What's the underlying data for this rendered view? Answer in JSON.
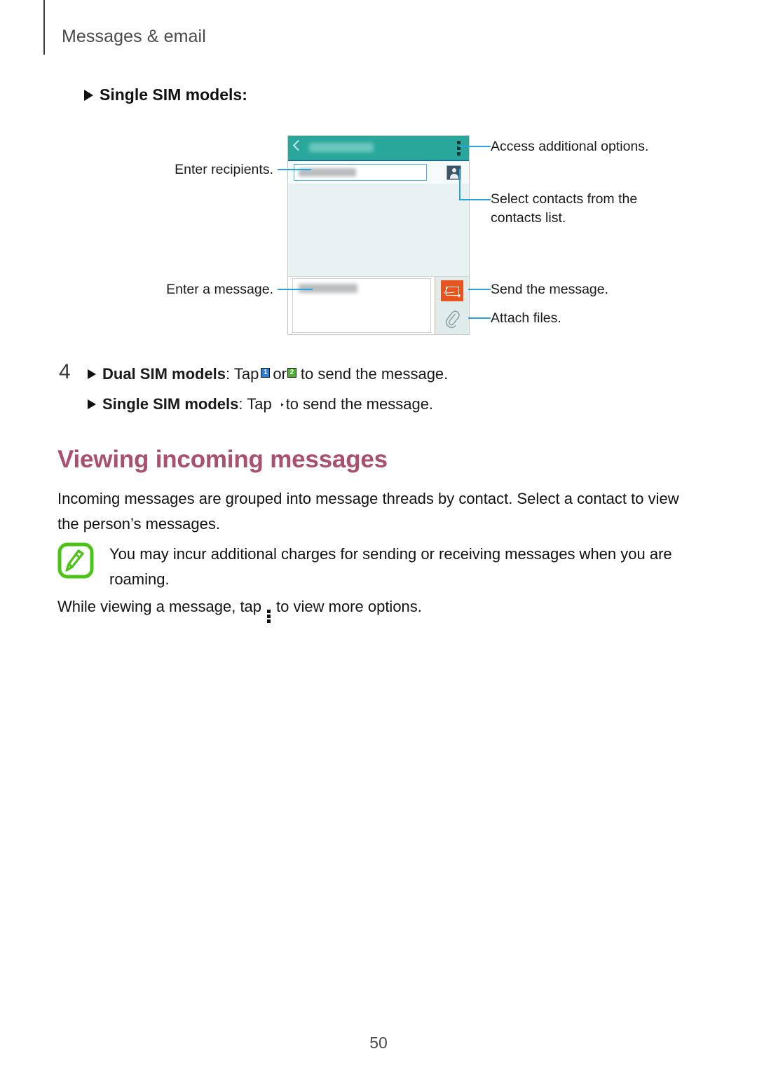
{
  "page": {
    "running_header": "Messages & email",
    "number": "50"
  },
  "subhead": {
    "label": "Single SIM models:"
  },
  "figure": {
    "phone": {
      "topbar_title_blurred": "New message",
      "recipient_placeholder_blurred": "Enter recipient",
      "compose_placeholder_blurred": "Enter message",
      "icons": {
        "back": "back-chevron-icon",
        "overflow": "kebab-menu-icon",
        "contacts": "contact-picker-icon",
        "send": "send-message-icon",
        "attach": "paperclip-icon"
      }
    },
    "annotations": {
      "left": [
        {
          "text": "Enter recipients."
        },
        {
          "text": "Enter a message."
        }
      ],
      "right": [
        {
          "text": "Access additional options."
        },
        {
          "text": "Select contacts from the\ncontacts list."
        },
        {
          "text": "Send the message."
        },
        {
          "text": "Attach files."
        }
      ]
    }
  },
  "step4": {
    "number": "4",
    "dual": {
      "bold": "Dual SIM models",
      "after_bold": ": Tap",
      "between_icons": "or",
      "tail": "to send the message.",
      "sim1_label": "1",
      "sim2_label": "2"
    },
    "single": {
      "bold": "Single SIM models",
      "after_bold": ": Tap",
      "tail": "to send the message."
    }
  },
  "section": {
    "heading": "Viewing incoming messages",
    "intro": "Incoming messages are grouped into message threads by contact. Select a contact to view the person’s messages.",
    "note": "You may incur additional charges for sending or receiving messages when you are roaming.",
    "tip_before": "While viewing a message, tap",
    "tip_after": "to view more options."
  },
  "colors": {
    "teal": "#2aa79b",
    "orange": "#e8531e",
    "leader_blue": "#29a3dc",
    "heading_mauve": "#a9506c",
    "note_green": "#4cc417",
    "sim1_blue": "#2a7fd4",
    "sim2_green": "#49b12b"
  }
}
